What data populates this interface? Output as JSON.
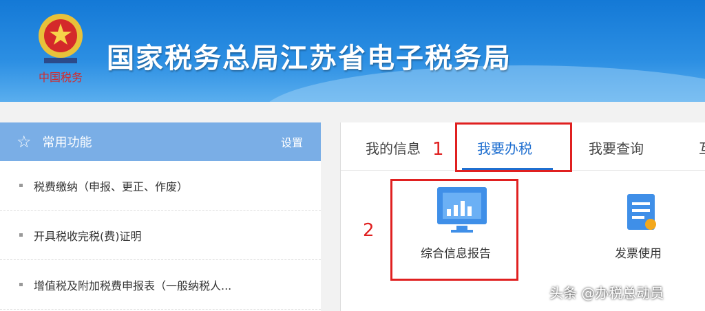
{
  "header": {
    "title": "国家税务总局江苏省电子税务局",
    "emblem_text": "中国税务"
  },
  "sidebar": {
    "title": "常用功能",
    "settings": "设置",
    "items": [
      "税费缴纳（申报、更正、作废）",
      "开具税收完税(费)证明",
      "增值税及附加税费申报表（一般纳税人..."
    ]
  },
  "tabs": [
    "我的信息",
    "我要办税",
    "我要查询",
    "互"
  ],
  "annot": {
    "one": "1",
    "two": "2"
  },
  "tiles": [
    "综合信息报告",
    "发票使用"
  ],
  "watermark": "头条 @办税总动员"
}
